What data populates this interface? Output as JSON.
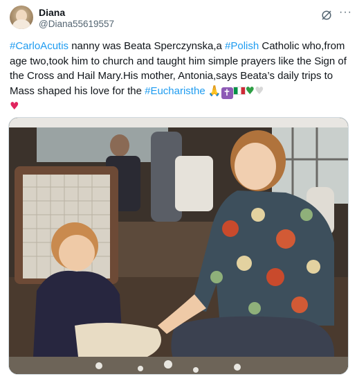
{
  "user": {
    "name": "Diana",
    "handle": "@Diana55619557"
  },
  "header_icons": [
    "grok-icon",
    "more-icon"
  ],
  "more_glyph": "···",
  "tweet": {
    "seg1_tag": "#CarloAcutis",
    "seg2": " nanny was Beata Sperczynska,a ",
    "seg3_tag": "#Polish",
    "seg4": " Catholic who,from age two,took him to church and taught him simple prayers like the Sign of the Cross and Hail Mary.His mother, Antonia,says Beata’s daily trips to Mass shaped his love for the ",
    "seg5_tag": "#Eucharisthe",
    "emoji_pray": "🙏",
    "emoji_cross": "✝",
    "emoji_green_heart": "♥",
    "emoji_white_heart": "♥",
    "emoji_red_heart": "♥"
  },
  "colors": {
    "link": "#1d9bf0",
    "text": "#0f1419",
    "secondary": "#536471"
  },
  "media": {
    "kind": "photo",
    "subject": "woman in floral blouse sitting with young boy in navy sweater on a porch beside a wicker chair"
  }
}
